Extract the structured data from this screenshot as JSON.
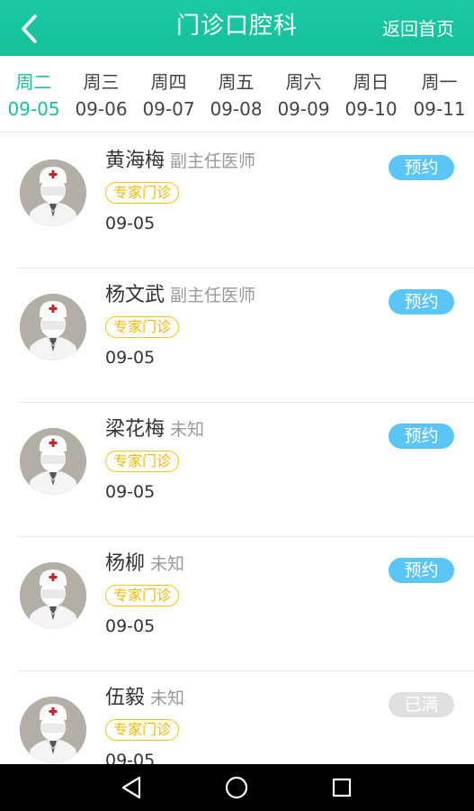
{
  "header": {
    "title": "门诊口腔科",
    "home_label": "返回首页"
  },
  "colors": {
    "header": "#18c39f",
    "active_tab": "#1bbf9b",
    "book_button": "#5bc5f5",
    "full_button": "#e0e0e0",
    "tag": "#f5c518"
  },
  "dates": [
    {
      "weekday": "周二",
      "date": "09-05",
      "active": true
    },
    {
      "weekday": "周三",
      "date": "09-06",
      "active": false
    },
    {
      "weekday": "周四",
      "date": "09-07",
      "active": false
    },
    {
      "weekday": "周五",
      "date": "09-08",
      "active": false
    },
    {
      "weekday": "周六",
      "date": "09-09",
      "active": false
    },
    {
      "weekday": "周日",
      "date": "09-10",
      "active": false
    },
    {
      "weekday": "周一",
      "date": "09-11",
      "active": false
    }
  ],
  "doctors": [
    {
      "name": "黄海梅",
      "title": "副主任医师",
      "tag": "专家门诊",
      "date": "09-05",
      "action": "预约",
      "status": "available"
    },
    {
      "name": "杨文武",
      "title": "副主任医师",
      "tag": "专家门诊",
      "date": "09-05",
      "action": "预约",
      "status": "available"
    },
    {
      "name": "梁花梅",
      "title": "未知",
      "tag": "专家门诊",
      "date": "09-05",
      "action": "预约",
      "status": "available"
    },
    {
      "name": "杨柳",
      "title": "未知",
      "tag": "专家门诊",
      "date": "09-05",
      "action": "预约",
      "status": "available"
    },
    {
      "name": "伍毅",
      "title": "未知",
      "tag": "专家门诊",
      "date": "09-05",
      "action": "已满",
      "status": "full"
    }
  ],
  "icons": {
    "back": "chevron-left-icon",
    "avatar": "doctor-avatar-icon",
    "nav_back": "triangle-back-icon",
    "nav_home": "circle-home-icon",
    "nav_recent": "square-recent-icon"
  }
}
